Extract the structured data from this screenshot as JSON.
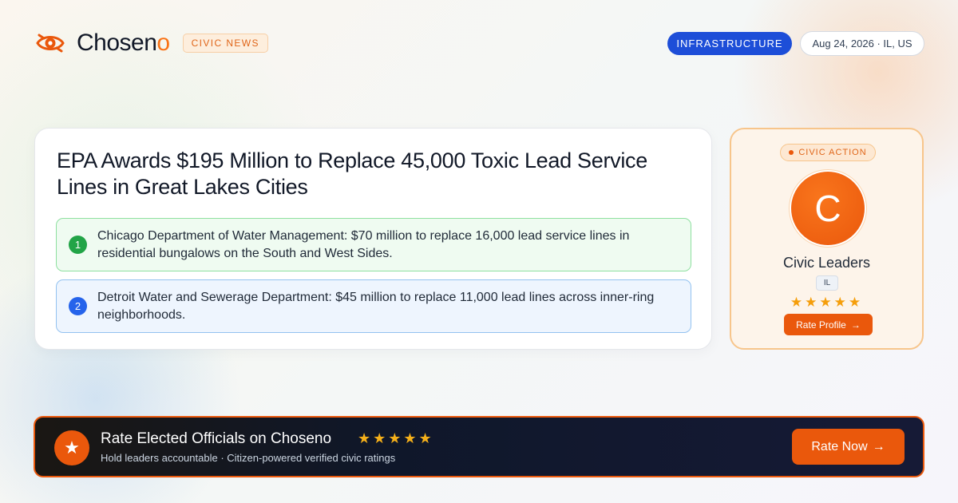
{
  "header": {
    "brand_name_main": "Chosen",
    "brand_name_accent": "o",
    "news_tag": "CIVIC NEWS",
    "topic": "INFRASTRUCTURE",
    "date_location": "Aug 24, 2026 · IL, US"
  },
  "article": {
    "headline": "EPA Awards $195 Million to Replace 45,000 Toxic Lead Service Lines in Great Lakes Cities",
    "points": [
      {
        "number": "1",
        "text": "Chicago Department of Water Management: $70 million to replace 16,000 lead service lines in residential bungalows on the South and West Sides."
      },
      {
        "number": "2",
        "text": "Detroit Water and Sewerage Department: $45 million to replace 11,000 lead lines across inner-ring neighborhoods."
      }
    ]
  },
  "civic_action": {
    "tag": "CIVIC ACTION",
    "avatar_initial": "C",
    "leader_name": "Civic Leaders",
    "state": "IL",
    "stars": "★★★★★",
    "button_label": "Rate Profile",
    "button_arrow": "→"
  },
  "cta": {
    "badge_icon": "★",
    "title": "Rate Elected Officials on Choseno",
    "stars": "★★★★★",
    "subtitle": "Hold leaders accountable · Citizen-powered verified civic ratings",
    "button_label": "Rate Now",
    "button_arrow": "→"
  },
  "colors": {
    "accent": "#ea580c",
    "topic_blue": "#1d4ed8",
    "point1_green": "#22a447",
    "point2_blue": "#2563eb",
    "star": "#f59e0b"
  }
}
